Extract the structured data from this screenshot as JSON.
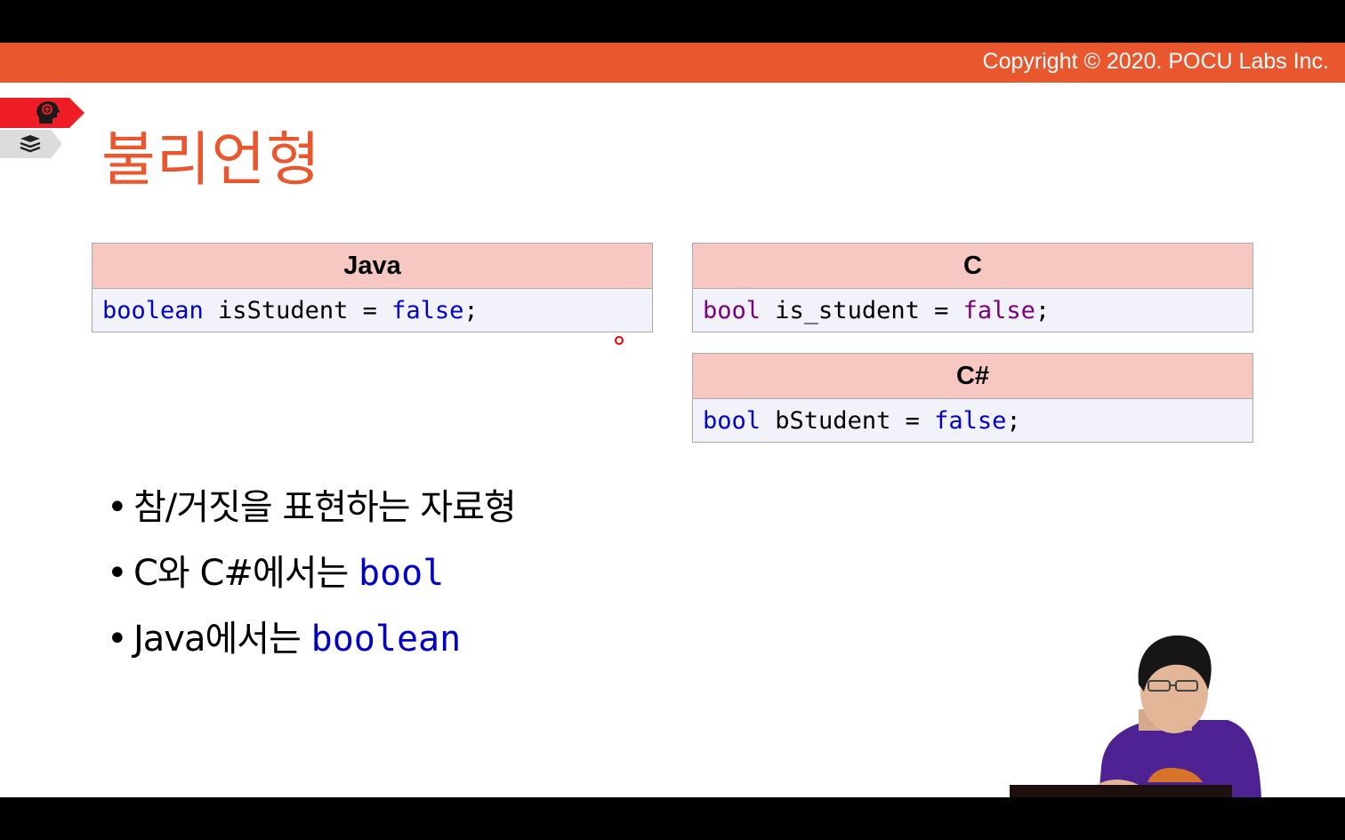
{
  "header": {
    "copyright": "Copyright © 2020. POCU Labs Inc."
  },
  "icons": {
    "tag_top": "brain-head-icon",
    "tag_bottom": "book-stack-icon"
  },
  "slide": {
    "title": "불리언형",
    "java": {
      "label": "Java",
      "keyword": "boolean",
      "rest": " isStudent = ",
      "value": "false",
      "end": ";"
    },
    "c": {
      "label": "C",
      "keyword": "bool",
      "rest": " is_student = ",
      "value": "false",
      "end": ";"
    },
    "csharp": {
      "label": "C#",
      "keyword": "bool",
      "rest": " bStudent = ",
      "value": "false",
      "end": ";"
    },
    "bullets": [
      {
        "text": "참/거짓을 표현하는 자료형",
        "code": ""
      },
      {
        "text": "C와 C#에서는 ",
        "code": "bool"
      },
      {
        "text": "Java에서는 ",
        "code": "boolean"
      }
    ],
    "bullet_char": "•"
  },
  "colors": {
    "accent": "#e8572e",
    "code_header": "#f7c8c1",
    "keyword": "#0000c8",
    "c_type": "#7a0080"
  }
}
